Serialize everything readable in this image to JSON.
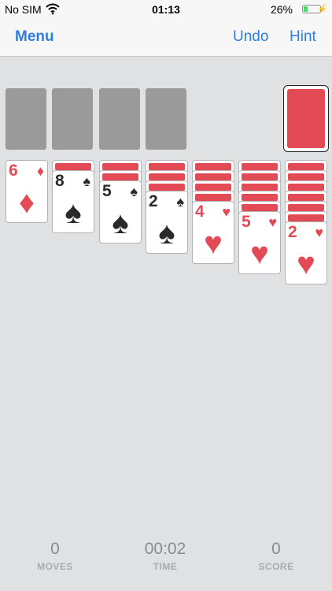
{
  "status_bar": {
    "carrier": "No SIM",
    "time": "01:13",
    "battery_percent": "26%",
    "battery_level": 0.26,
    "icons": [
      "wifi-icon",
      "battery-icon",
      "charging-bolt-icon"
    ]
  },
  "nav": {
    "menu_label": "Menu",
    "undo_label": "Undo",
    "hint_label": "Hint",
    "accent_color": "#2f7de1"
  },
  "foundations": [
    {
      "state": "empty"
    },
    {
      "state": "empty"
    },
    {
      "state": "empty"
    },
    {
      "state": "empty"
    }
  ],
  "stock": {
    "state": "face-down"
  },
  "tableau": [
    {
      "hidden_count": 0,
      "rank": "6",
      "suit": "diamonds",
      "suit_symbol": "♦",
      "color": "red"
    },
    {
      "hidden_count": 1,
      "rank": "8",
      "suit": "spades",
      "suit_symbol": "♠",
      "color": "black"
    },
    {
      "hidden_count": 2,
      "rank": "5",
      "suit": "spades",
      "suit_symbol": "♠",
      "color": "black"
    },
    {
      "hidden_count": 3,
      "rank": "2",
      "suit": "spades",
      "suit_symbol": "♠",
      "color": "black"
    },
    {
      "hidden_count": 4,
      "rank": "4",
      "suit": "hearts",
      "suit_symbol": "♥",
      "color": "red"
    },
    {
      "hidden_count": 5,
      "rank": "5",
      "suit": "hearts",
      "suit_symbol": "♥",
      "color": "red"
    },
    {
      "hidden_count": 6,
      "rank": "2",
      "suit": "hearts",
      "suit_symbol": "♥",
      "color": "red"
    }
  ],
  "stats": {
    "moves_value": "0",
    "moves_label": "MOVES",
    "time_value": "00:02",
    "time_label": "TIME",
    "score_value": "0",
    "score_label": "SCORE"
  },
  "colors": {
    "card_red": "#e24b55",
    "card_black": "#2a2a2a",
    "table": "#dfe1e2",
    "foundation_slot": "#9a9a9a"
  }
}
